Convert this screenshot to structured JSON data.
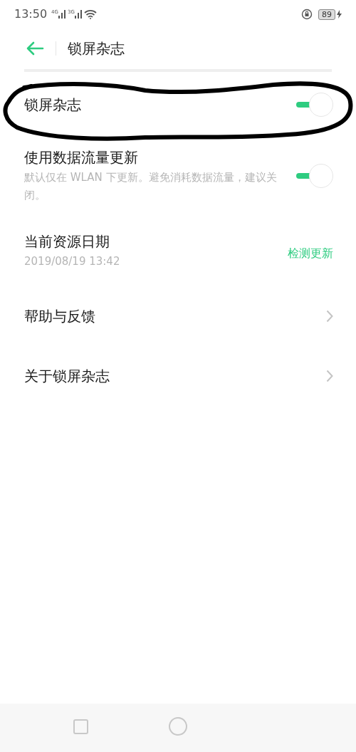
{
  "status_bar": {
    "time": "13:50",
    "signals": [
      "4G",
      "3G"
    ],
    "battery": "89",
    "charging": true
  },
  "header": {
    "title": "锁屏杂志"
  },
  "rows": [
    {
      "kind": "toggle",
      "title": "锁屏杂志",
      "on": true,
      "circled": true
    },
    {
      "kind": "toggle",
      "title": "使用数据流量更新",
      "subtitle": "默认仅在 WLAN 下更新。避免消耗数据流量，建议关闭。",
      "on": true,
      "circled": false
    },
    {
      "kind": "action",
      "title": "当前资源日期",
      "subtitle": "2019/08/19 13:42",
      "action": "检测更新"
    },
    {
      "kind": "chevron",
      "title": "帮助与反馈"
    },
    {
      "kind": "chevron",
      "title": "关于锁屏杂志"
    }
  ]
}
